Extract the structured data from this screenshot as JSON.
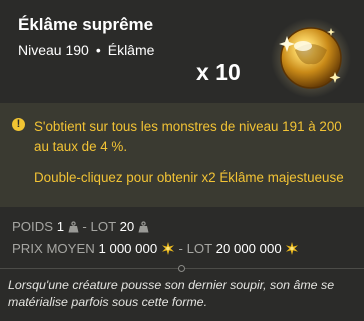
{
  "item": {
    "name": "Éklâme suprême",
    "level": "Niveau 190",
    "separator": "•",
    "type": "Éklâme",
    "quantity": "x 10",
    "icon": "golden-orb-icon"
  },
  "info": {
    "warning_icon": "exclamation-icon",
    "obtain_text": "S'obtient sur tous les monstres de niveau 191 à 200 au taux de 4 %.",
    "double_click_text": "Double-cliquez pour obtenir x2 Éklâme majestueuse"
  },
  "stats": {
    "weight_label": "POIDS",
    "weight_value": "1",
    "lot_label": "LOT",
    "lot_weight_value": "20",
    "dash": "-",
    "price_label": "PRIX MOYEN",
    "price_value": "1 000 000",
    "lot_price_value": "20 000 000",
    "weight_icon": "weight-icon",
    "kamas_icon": "kamas-icon"
  },
  "description": "Lorsqu'une créature pousse son dernier soupir, son âme se matérialise parfois sous cette forme.",
  "colors": {
    "background": "#2b2b29",
    "info_panel": "#3a3a31",
    "accent_yellow": "#f2c335",
    "label_grey": "#a6a6a2"
  }
}
